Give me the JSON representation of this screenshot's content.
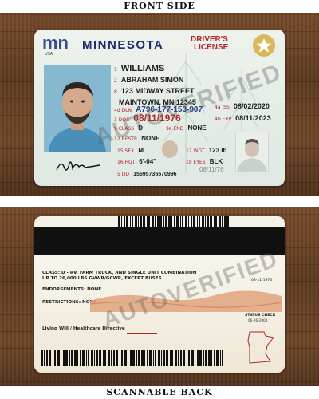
{
  "labels": {
    "front_side": "FRONT SIDE",
    "scannable_back": "SCANNABLE BACK"
  },
  "front": {
    "logo_mark": "mn",
    "logo_sub": "USA",
    "state": "MINNESOTA",
    "doc_type_1": "DRIVER'S",
    "doc_type_2": "LICENSE",
    "fields": {
      "n1": "1",
      "last_name": "WILLIAMS",
      "n2": "2",
      "first_name": "ABRAHAM SIMON",
      "n8": "8",
      "address_1": "123 MIDWAY STREET",
      "address_2": "MAINTOWN, MN 12345",
      "dl_label": "4d DLN",
      "dl_number": "A796-177-153-907",
      "iss_label": "4a ISS",
      "iss_date": "08/02/2020",
      "exp_label": "4b EXP",
      "exp_date": "08/11/2023",
      "dob_label": "3 DOB",
      "dob": "08/11/1976",
      "class_label": "9 CLASS",
      "class": "D",
      "end_label": "9a END",
      "end": "NONE",
      "rest_label": "12 RESTR",
      "rest": "NONE",
      "sex_label": "15 SEX",
      "sex": "M",
      "wgt_label": "17 WGT",
      "wgt": "123 lb",
      "hgt_label": "16 HGT",
      "hgt": "6'-04\"",
      "eyes_label": "18 EYES",
      "eyes": "BLK",
      "dd_label": "5 DD",
      "dd": "15595735570996",
      "ghost_dob": "08/11/76"
    },
    "watermark": "AUTOVERIFIED"
  },
  "back": {
    "class_text_1": "CLASS: D - RV, FARM TRUCK, AND SINGLE UNIT COMBINATION",
    "class_text_2": "UP TO 26,000 LBS GVWR/GCWR, EXCEPT BUSES",
    "dob_small": "08-11-1976",
    "endorsements": "ENDORSEMENTS: NONE",
    "restrictions": "RESTRICTIONS: NONE",
    "status_check": "STATUS CHECK",
    "status_date": "06-26-2004",
    "living_will": "Living Will / Healthcare Directive",
    "watermark": "AUTOVERIFIED"
  }
}
